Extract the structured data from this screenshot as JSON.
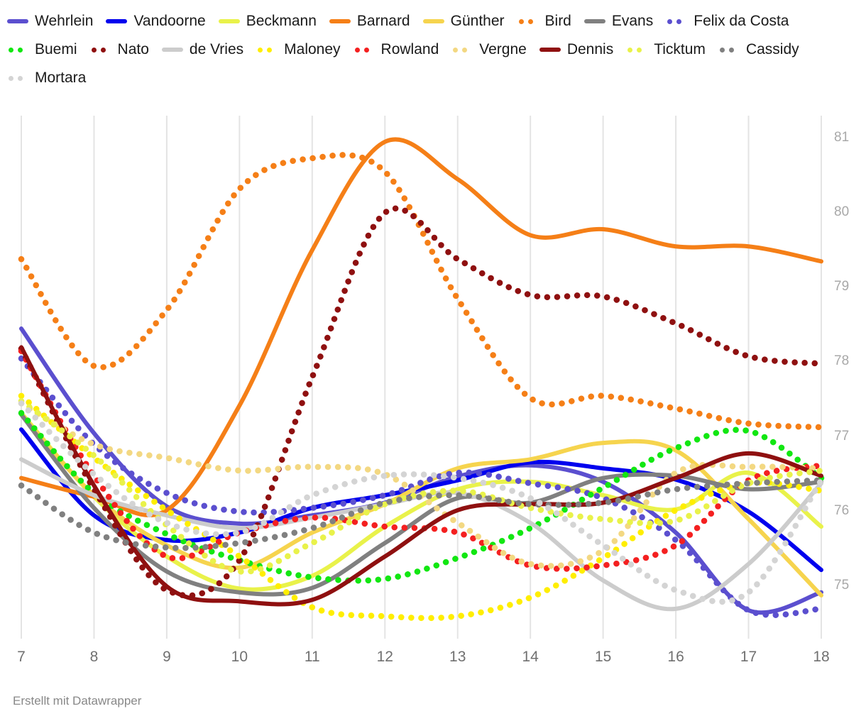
{
  "footer": {
    "text": "Erstellt mit Datawrapper"
  },
  "legend": {
    "items": [
      {
        "label": "Wehrlein",
        "color": "#5b4fcf",
        "style": "solid"
      },
      {
        "label": "Vandoorne",
        "color": "#0000ee",
        "style": "solid"
      },
      {
        "label": "Beckmann",
        "color": "#e9f24a",
        "style": "solid"
      },
      {
        "label": "Barnard",
        "color": "#f57f17",
        "style": "solid"
      },
      {
        "label": "Günther",
        "color": "#f6d44e",
        "style": "solid"
      },
      {
        "label": "Bird",
        "color": "#f57f17",
        "style": "dotted"
      },
      {
        "label": "Evans",
        "color": "#808080",
        "style": "solid"
      },
      {
        "label": "Felix da Costa",
        "color": "#5b4fcf",
        "style": "dotted"
      },
      {
        "label": "Buemi",
        "color": "#12e712",
        "style": "dotted"
      },
      {
        "label": "Nato",
        "color": "#8f1010",
        "style": "dotted"
      },
      {
        "label": "de Vries",
        "color": "#cccccc",
        "style": "solid"
      },
      {
        "label": "Maloney",
        "color": "#ffee00",
        "style": "dotted"
      },
      {
        "label": "Rowland",
        "color": "#f42020",
        "style": "dotted"
      },
      {
        "label": "Vergne",
        "color": "#f3d882",
        "style": "dotted"
      },
      {
        "label": "Dennis",
        "color": "#8f1010",
        "style": "solid"
      },
      {
        "label": "Ticktum",
        "color": "#e9f24a",
        "style": "dotted"
      },
      {
        "label": "Cassidy",
        "color": "#808080",
        "style": "dotted"
      },
      {
        "label": "Mortara",
        "color": "#d4d4d4",
        "style": "dotted"
      }
    ]
  },
  "chart_data": {
    "type": "line",
    "title": "",
    "subtitle": "",
    "xlabel": "",
    "ylabel": "",
    "xlim": [
      7,
      18
    ],
    "ylim": [
      74.3,
      81.3
    ],
    "grid": "vertical",
    "legend_position": "top",
    "x": [
      7,
      8,
      9,
      10,
      11,
      12,
      13,
      14,
      15,
      16,
      17,
      18
    ],
    "xticks": [
      "7",
      "8",
      "9",
      "10",
      "11",
      "12",
      "13",
      "14",
      "15",
      "16",
      "17",
      "18"
    ],
    "yticks": [
      "81",
      "80",
      "79",
      "78",
      "77",
      "76",
      "75"
    ],
    "ytick_values": [
      81,
      80,
      79,
      78,
      77,
      76,
      75
    ],
    "series": [
      {
        "name": "Wehrlein",
        "color": "#5b4fcf",
        "style": "solid",
        "values": [
          78.45,
          77.05,
          76.07,
          75.84,
          75.95,
          76.12,
          76.47,
          76.62,
          76.4,
          75.72,
          74.68,
          74.92
        ]
      },
      {
        "name": "Vandoorne",
        "color": "#0000ee",
        "style": "solid",
        "values": [
          77.1,
          75.95,
          75.62,
          75.72,
          76.05,
          76.22,
          76.42,
          76.66,
          76.58,
          76.43,
          76.0,
          75.22
        ]
      },
      {
        "name": "Beckmann",
        "color": "#e9f24a",
        "style": "solid",
        "values": [
          77.32,
          76.2,
          75.4,
          74.97,
          75.14,
          75.8,
          76.3,
          76.4,
          76.22,
          76.03,
          76.52,
          75.8
        ]
      },
      {
        "name": "Barnard",
        "color": "#f57f17",
        "style": "solid",
        "values": [
          76.45,
          76.2,
          76.02,
          77.42,
          79.5,
          80.95,
          80.45,
          79.7,
          79.78,
          79.55,
          79.55,
          79.35
        ]
      },
      {
        "name": "Günther",
        "color": "#f6d44e",
        "style": "solid",
        "values": [
          77.3,
          76.22,
          75.55,
          75.25,
          75.72,
          76.1,
          76.58,
          76.7,
          76.92,
          76.82,
          75.9,
          74.88
        ]
      },
      {
        "name": "Bird",
        "color": "#f57f17",
        "style": "dotted",
        "values": [
          79.38,
          77.95,
          78.7,
          80.32,
          80.73,
          80.55,
          78.85,
          77.52,
          77.55,
          77.38,
          77.18,
          77.13
        ]
      },
      {
        "name": "Evans",
        "color": "#808080",
        "style": "solid",
        "values": [
          77.3,
          76.05,
          75.2,
          74.92,
          74.98,
          75.58,
          76.18,
          76.12,
          76.45,
          76.48,
          76.3,
          76.4
        ]
      },
      {
        "name": "Felix da Costa",
        "color": "#5b4fcf",
        "style": "dotted",
        "values": [
          78.05,
          76.9,
          76.25,
          76.0,
          76.05,
          76.22,
          76.52,
          76.38,
          76.18,
          75.62,
          74.68,
          74.7
        ]
      },
      {
        "name": "Buemi",
        "color": "#12e712",
        "style": "dotted",
        "values": [
          77.32,
          76.25,
          75.7,
          75.35,
          75.12,
          75.1,
          75.38,
          75.78,
          76.32,
          76.85,
          77.08,
          76.45
        ]
      },
      {
        "name": "Nato",
        "color": "#8f1010",
        "style": "dotted",
        "values": [
          78.18,
          76.3,
          74.95,
          75.35,
          77.8,
          80.0,
          79.38,
          78.9,
          78.88,
          78.52,
          78.08,
          77.98
        ]
      },
      {
        "name": "de Vries",
        "color": "#cccccc",
        "style": "solid",
        "values": [
          76.7,
          76.22,
          75.95,
          75.78,
          75.92,
          76.1,
          76.25,
          75.85,
          75.08,
          74.7,
          75.3,
          76.38
        ]
      },
      {
        "name": "Maloney",
        "color": "#ffee00",
        "style": "dotted",
        "values": [
          77.55,
          76.72,
          76.02,
          75.4,
          74.72,
          74.6,
          74.6,
          74.85,
          75.38,
          76.02,
          76.38,
          76.28
        ]
      },
      {
        "name": "Rowland",
        "color": "#f42020",
        "style": "dotted",
        "values": [
          78.15,
          76.48,
          75.4,
          75.72,
          75.92,
          75.8,
          75.72,
          75.28,
          75.28,
          75.55,
          76.42,
          76.62
        ]
      },
      {
        "name": "Vergne",
        "color": "#f3d882",
        "style": "dotted",
        "values": [
          77.45,
          76.9,
          76.72,
          76.55,
          76.6,
          76.5,
          75.85,
          75.3,
          75.48,
          76.52,
          76.6,
          76.58
        ]
      },
      {
        "name": "Dennis",
        "color": "#8f1010",
        "style": "solid",
        "values": [
          78.2,
          76.35,
          75.0,
          74.8,
          74.82,
          75.4,
          76.02,
          76.1,
          76.12,
          76.45,
          76.78,
          76.48
        ]
      },
      {
        "name": "Ticktum",
        "color": "#e9f24a",
        "style": "dotted",
        "values": [
          77.48,
          76.75,
          75.82,
          75.2,
          75.58,
          76.1,
          76.28,
          76.05,
          75.9,
          75.88,
          76.38,
          76.55
        ]
      },
      {
        "name": "Cassidy",
        "color": "#808080",
        "style": "dotted",
        "values": [
          76.35,
          75.72,
          75.52,
          75.58,
          75.78,
          76.12,
          76.22,
          76.1,
          76.12,
          76.3,
          76.38,
          76.42
        ]
      },
      {
        "name": "Mortara",
        "color": "#d4d4d4",
        "style": "dotted",
        "values": [
          77.45,
          76.5,
          75.85,
          75.72,
          76.22,
          76.48,
          76.45,
          76.18,
          75.55,
          74.95,
          74.92,
          76.42
        ]
      }
    ]
  }
}
